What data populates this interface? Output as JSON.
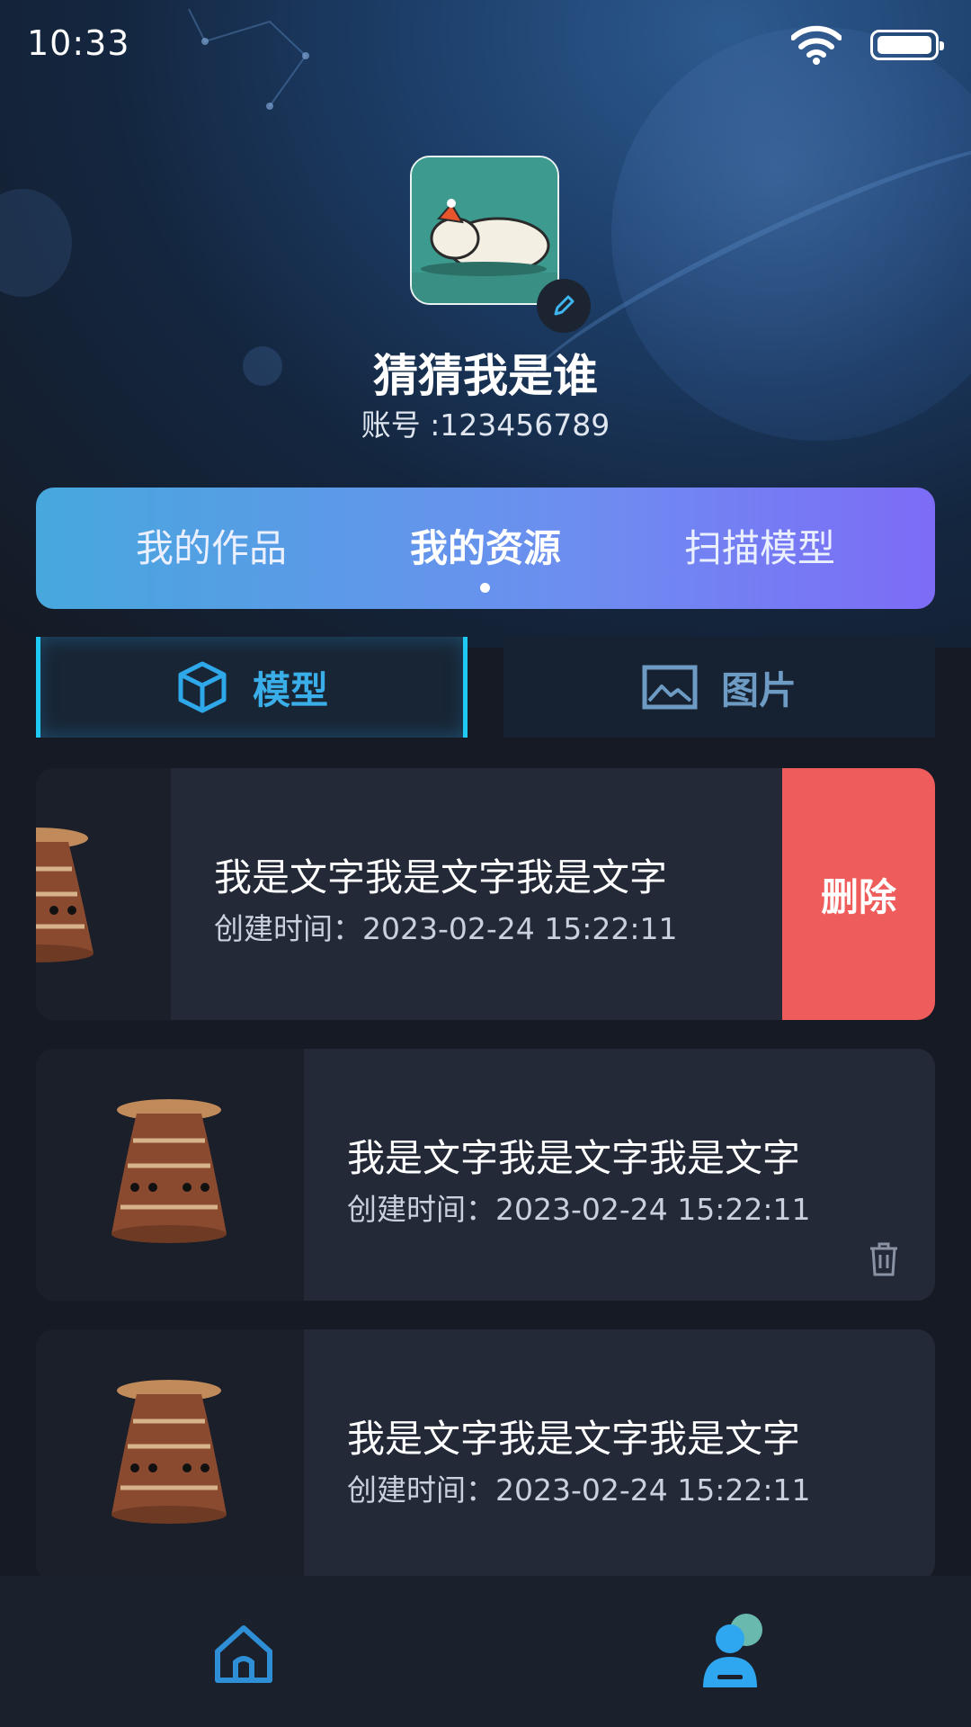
{
  "status_bar": {
    "time": "10:33"
  },
  "profile": {
    "nickname": "猜猜我是谁",
    "account": "账号 :123456789"
  },
  "tabs": [
    {
      "label": "我的作品",
      "active": false
    },
    {
      "label": "我的资源",
      "active": true
    },
    {
      "label": "扫描模型",
      "active": false
    }
  ],
  "segments": [
    {
      "label": "模型",
      "icon": "cube-icon",
      "active": true
    },
    {
      "label": "图片",
      "icon": "image-icon",
      "active": false
    }
  ],
  "items": [
    {
      "title": "我是文字我是文字我是文字",
      "time": "创建时间：2023-02-24 15:22:11",
      "delete_label": "删除"
    },
    {
      "title": "我是文字我是文字我是文字",
      "time": "创建时间：2023-02-24 15:22:11"
    },
    {
      "title": "我是文字我是文字我是文字",
      "time": "创建时间：2023-02-24 15:22:11"
    }
  ],
  "colors": {
    "accent": "#1ec9f4",
    "delete": "#ee5c5c",
    "tab_start": "#47a8dd",
    "tab_end": "#7d6cf6"
  },
  "bottom_nav": [
    {
      "icon": "home-icon",
      "active": false
    },
    {
      "icon": "profile-icon",
      "active": true
    }
  ]
}
